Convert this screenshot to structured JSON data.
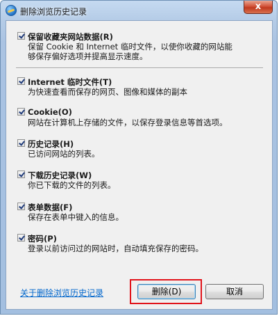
{
  "window": {
    "title": "删除浏览历史记录",
    "close_label": "x"
  },
  "options": [
    {
      "label": "保留收藏夹网站数据(R)",
      "desc": [
        "保留 Cookie 和 Internet 临时文件，以使你收藏的网站能",
        "够保存偏好选项并提高显示速度。"
      ],
      "checked": true
    },
    {
      "label": "Internet 临时文件(T)",
      "desc": [
        "为快速查看而保存的网页、图像和媒体的副本"
      ],
      "checked": true
    },
    {
      "label": "Cookie(O)",
      "desc": [
        "网站在计算机上存储的文件，以保存登录信息等首选项。"
      ],
      "checked": true
    },
    {
      "label": "历史记录(H)",
      "desc": [
        "已访问网站的列表。"
      ],
      "checked": true
    },
    {
      "label": "下载历史记录(W)",
      "desc": [
        "你已下载的文件的列表。"
      ],
      "checked": true
    },
    {
      "label": "表单数据(F)",
      "desc": [
        "保存在表单中键入的信息。"
      ],
      "checked": true
    },
    {
      "label": "密码(P)",
      "desc": [
        "登录以前访问过的网站时，自动填充保存的密码。"
      ],
      "checked": true
    }
  ],
  "footer": {
    "link_label": "关于删除浏览历史记录",
    "delete_label": "删除(D)",
    "cancel_label": "取消"
  },
  "colors": {
    "highlight": "#e1131a",
    "link": "#0066cc"
  }
}
